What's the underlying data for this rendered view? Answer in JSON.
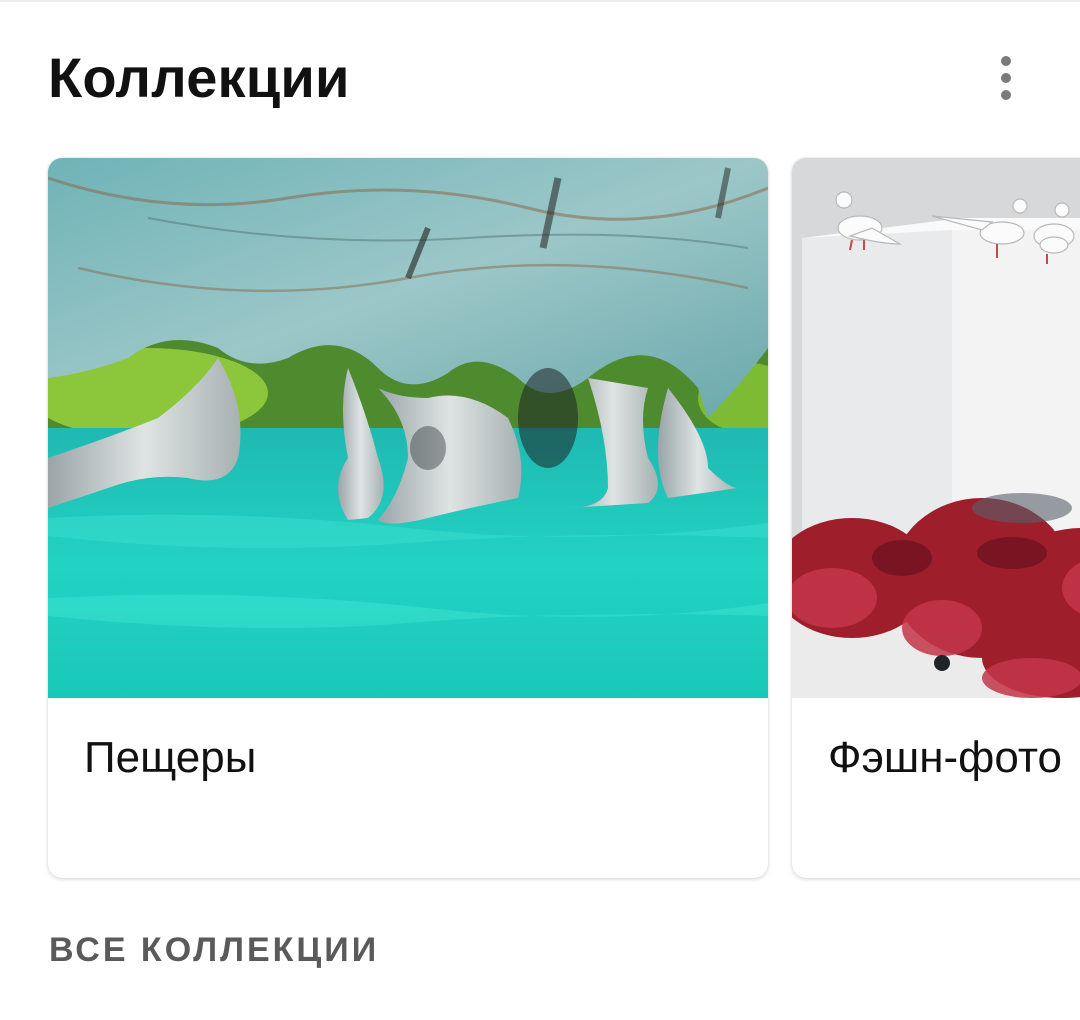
{
  "section": {
    "title": "Коллекции",
    "menu_icon": "more-vertical-icon"
  },
  "collections": [
    {
      "label": "Пещеры"
    },
    {
      "label": "Фэшн-фото"
    }
  ],
  "footer": {
    "all_link": "ВСЕ КОЛЛЕКЦИИ"
  },
  "colors": {
    "title": "#111111",
    "link": "#5a5a5a",
    "menu_dots": "#7a7a7a"
  }
}
